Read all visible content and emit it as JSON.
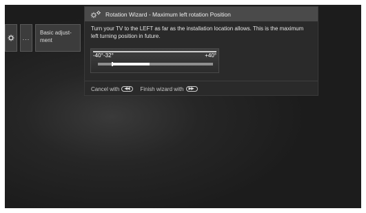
{
  "menu": {
    "gear_icon": "gear-icon",
    "dots_label": "...",
    "basic_line1": "Basic adjust-",
    "basic_line2": "ment"
  },
  "dialog": {
    "title": "Rotation Wizard - Maximum left rotation Position",
    "icon": "gears-icon",
    "body": "Turn your TV to the LEFT as far as the installation location allows. This is the maximum left turning position in future.",
    "scale": {
      "min_label": "-40°",
      "current_label": "-32°",
      "max_label": "+40°",
      "range": [
        -40,
        40
      ],
      "current": -32,
      "fill_fraction": 0.45
    },
    "footer": {
      "cancel_label": "Cancel with",
      "cancel_icon": "rewind-button-icon",
      "finish_label": "Finish wizard with",
      "finish_icon": "fast-forward-button-icon"
    }
  }
}
